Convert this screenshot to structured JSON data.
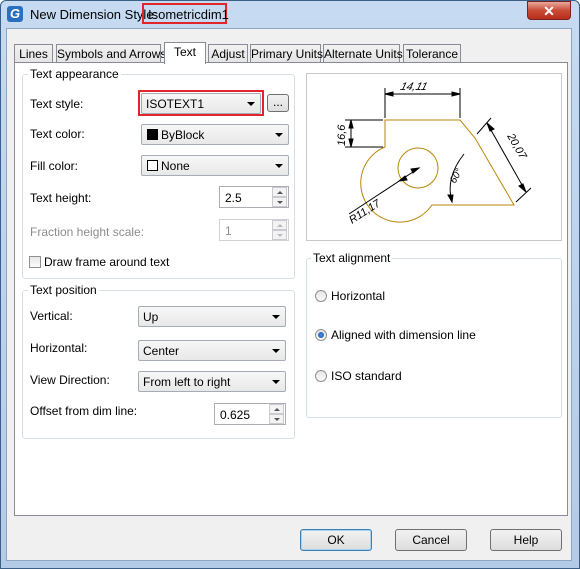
{
  "window": {
    "title_prefix": "New Dimension Style:",
    "style_name": "Isometricdim1",
    "close_label": "✕",
    "app_icon": "gstarcad-logo-icon"
  },
  "tabs": [
    {
      "label": "Lines",
      "active": false
    },
    {
      "label": "Symbols and Arrows",
      "active": false
    },
    {
      "label": "Text",
      "active": true
    },
    {
      "label": "Adjust",
      "active": false
    },
    {
      "label": "Primary Units",
      "active": false
    },
    {
      "label": "Alternate Units",
      "active": false
    },
    {
      "label": "Tolerance",
      "active": false
    }
  ],
  "text_appearance": {
    "title": "Text appearance",
    "text_style_label": "Text style:",
    "text_style_value": "ISOTEXT1",
    "browse_label": "...",
    "text_color_label": "Text color:",
    "text_color_value": "ByBlock",
    "fill_color_label": "Fill color:",
    "fill_color_value": "None",
    "text_height_label": "Text height:",
    "text_height_value": "2.5",
    "fraction_label": "Fraction height scale:",
    "fraction_value": "1",
    "draw_frame_label": "Draw frame around text",
    "draw_frame_checked": false
  },
  "text_position": {
    "title": "Text position",
    "vertical_label": "Vertical:",
    "vertical_value": "Up",
    "horizontal_label": "Horizontal:",
    "horizontal_value": "Center",
    "view_direction_label": "View Direction:",
    "view_direction_value": "From left to right",
    "offset_label": "Offset from dim line:",
    "offset_value": "0.625"
  },
  "preview": {
    "dim_top": "14,11",
    "dim_left": "16,6",
    "dim_right": "20,07",
    "dim_angle": "60°",
    "dim_radius": "R11,17",
    "outline_color": "#b8860b"
  },
  "text_alignment": {
    "title": "Text alignment",
    "options": [
      {
        "label": "Horizontal",
        "selected": false
      },
      {
        "label": "Aligned with dimension line",
        "selected": true
      },
      {
        "label": "ISO standard",
        "selected": false
      }
    ]
  },
  "buttons": {
    "ok": "OK",
    "cancel": "Cancel",
    "help": "Help"
  },
  "colors": {
    "highlight": "#e0262c",
    "close_button": "#c94a36"
  }
}
